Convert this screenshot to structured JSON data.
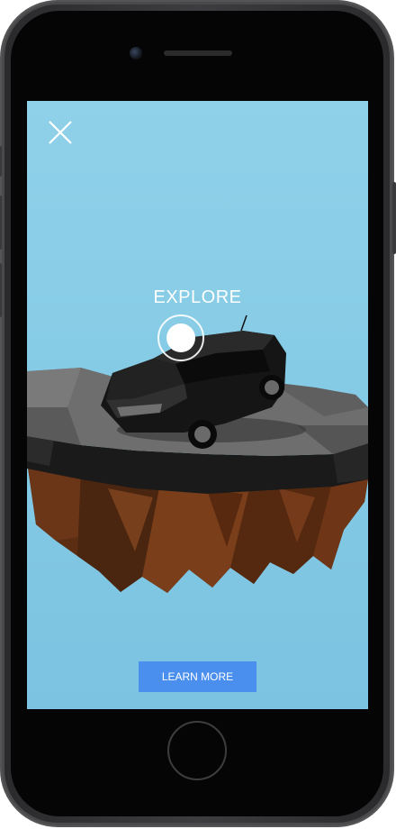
{
  "overlay": {
    "explore_label": "EXPLORE",
    "learn_more_label": "LEARN MORE"
  },
  "icons": {
    "close": "close-icon",
    "explore": "explore-hotspot-icon"
  },
  "colors": {
    "sky": "#86cbe6",
    "button": "#4a8fee",
    "text": "#ffffff"
  }
}
